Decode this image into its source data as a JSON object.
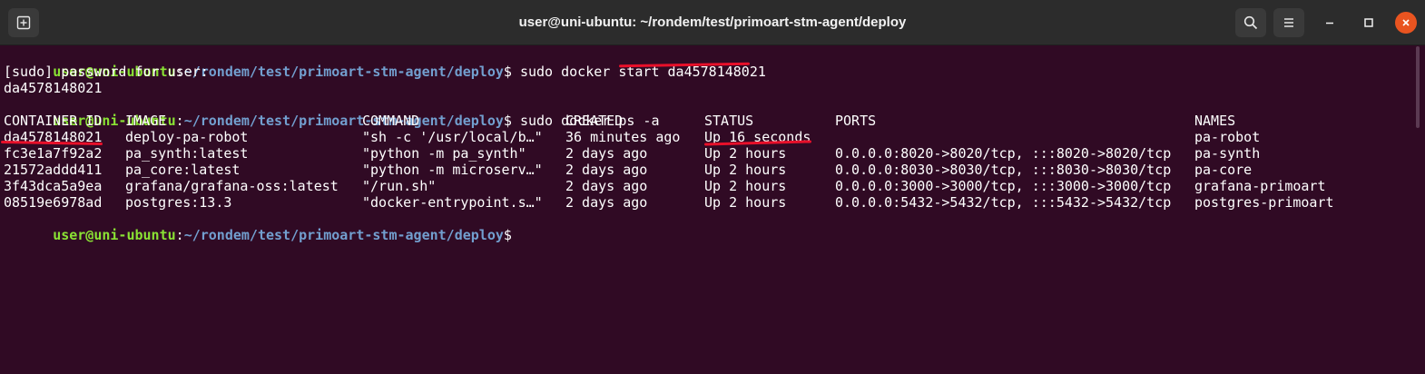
{
  "window": {
    "title": "user@uni-ubuntu: ~/rondem/test/primoart-stm-agent/deploy"
  },
  "prompt": {
    "user_host": "user@uni-ubuntu",
    "separator": ":",
    "path": "~/rondem/test/primoart-stm-agent/deploy",
    "dollar": "$"
  },
  "lines": {
    "cmd1": " sudo docker start da4578148021",
    "sudo_prompt": "[sudo] password for user:",
    "start_output": "da4578148021",
    "cmd2": " sudo docker ps -a"
  },
  "table": {
    "headers": [
      "CONTAINER ID",
      "IMAGE",
      "COMMAND",
      "CREATED",
      "STATUS",
      "PORTS",
      "NAMES"
    ],
    "rows": [
      [
        "da4578148021",
        "deploy-pa-robot",
        "\"sh -c '/usr/local/b…\"",
        "36 minutes ago",
        "Up 16 seconds",
        "",
        "pa-robot"
      ],
      [
        "fc3e1a7f92a2",
        "pa_synth:latest",
        "\"python -m pa_synth\"",
        "2 days ago",
        "Up 2 hours",
        "0.0.0.0:8020->8020/tcp, :::8020->8020/tcp",
        "pa-synth"
      ],
      [
        "21572addd411",
        "pa_core:latest",
        "\"python -m microserv…\"",
        "2 days ago",
        "Up 2 hours",
        "0.0.0.0:8030->8030/tcp, :::8030->8030/tcp",
        "pa-core"
      ],
      [
        "3f43dca5a9ea",
        "grafana/grafana-oss:latest",
        "\"/run.sh\"",
        "2 days ago",
        "Up 2 hours",
        "0.0.0.0:3000->3000/tcp, :::3000->3000/tcp",
        "grafana-primoart"
      ],
      [
        "08519e6978ad",
        "postgres:13.3",
        "\"docker-entrypoint.s…\"",
        "2 days ago",
        "Up 2 hours",
        "0.0.0.0:5432->5432/tcp, :::5432->5432/tcp",
        "postgres-primoart"
      ]
    ]
  },
  "icons": {
    "new_tab": "new-tab-icon",
    "search": "search-icon",
    "menu": "hamburger-menu-icon",
    "minimize": "minimize-icon",
    "maximize": "maximize-icon",
    "close": "close-icon"
  },
  "colors": {
    "background": "#300a24",
    "prompt_user": "#8ae234",
    "prompt_path": "#729fcf",
    "annotation": "#e8102a",
    "close_button": "#e95420"
  }
}
